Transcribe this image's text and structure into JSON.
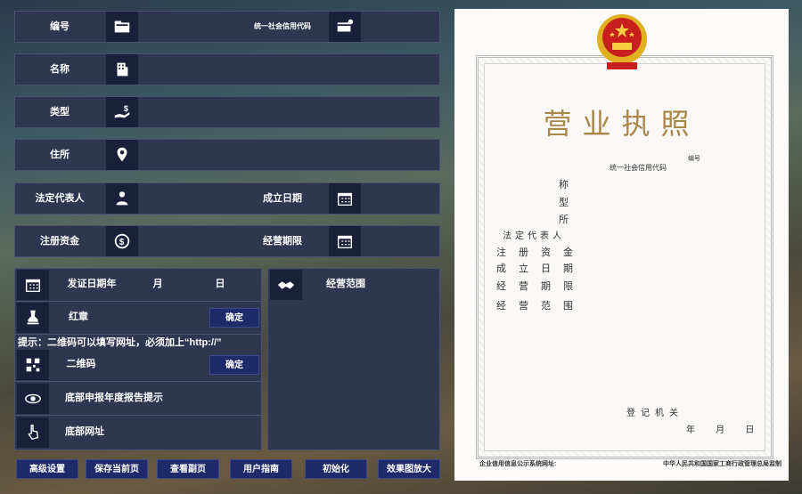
{
  "form": {
    "row1": {
      "label": "编号",
      "right_label": "统一社会信用代码"
    },
    "row2": {
      "label": "名称"
    },
    "row3": {
      "label": "类型"
    },
    "row4": {
      "label": "住所"
    },
    "row5": {
      "label": "法定代表人",
      "right_label": "成立日期"
    },
    "row6": {
      "label": "注册资金",
      "right_label": "经营期限"
    }
  },
  "panel": {
    "issue_date": {
      "label": "发证日期年",
      "month": "月",
      "day": "日"
    },
    "red_seal": {
      "label": "红章",
      "confirm": "确定"
    },
    "hint": "提示：二维码可以填写网址，必须加上“http://”",
    "qrcode": {
      "label": "二维码",
      "confirm": "确定"
    },
    "annual_report": {
      "label": "底部申报年度报告提示"
    },
    "bottom_url": {
      "label": "底部网址"
    },
    "business_scope": {
      "label": "经营范围"
    }
  },
  "buttons": [
    "高级设置",
    "保存当前页",
    "查看副页",
    "用户指南",
    "初始化",
    "效果图放大"
  ],
  "license": {
    "title": "营业执照",
    "number_label": "编号",
    "credit_code_label": "统一社会信用代码",
    "fields": [
      "称",
      "型",
      "所",
      "法定代表人",
      "注册资金",
      "成立日期",
      "经营期限",
      "经营范围"
    ],
    "registration_authority": "登记机关",
    "date_line": "年 月 日",
    "footer_left": "企业信用信息公示系统网址:",
    "footer_right": "中华人民共和国国家工商行政管理总局监制"
  },
  "colors": {
    "panel": "#2f3650",
    "icon_box": "#1a1f3a",
    "button": "#1e2a6a",
    "license_title": "#a8874a"
  }
}
